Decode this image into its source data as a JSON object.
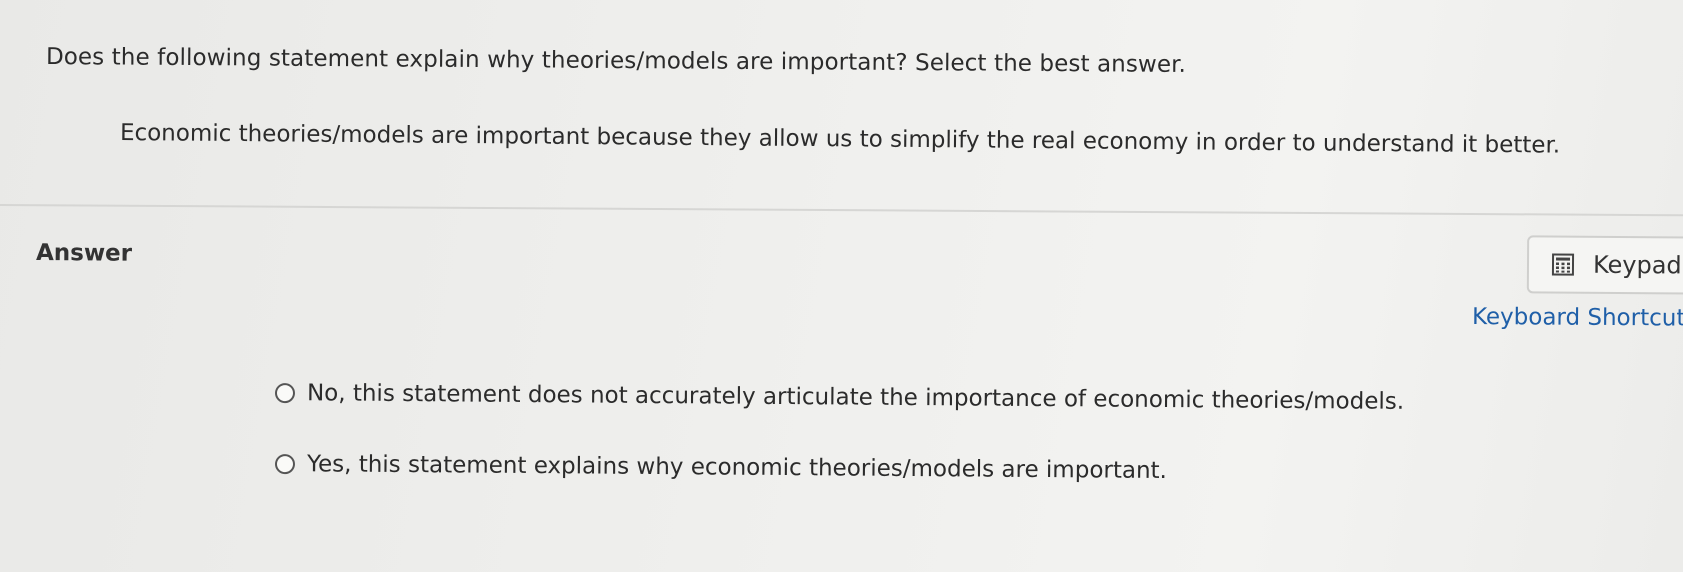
{
  "question": {
    "prompt": "Does the following statement explain why theories/models are important? Select the best answer.",
    "statement": "Economic theories/models are important because they allow us to simplify the real economy in order to understand it better."
  },
  "answer": {
    "heading": "Answer",
    "options": [
      {
        "label": "No, this statement does not accurately articulate the importance of economic theories/models.",
        "selected": false
      },
      {
        "label": "Yes, this statement explains why economic theories/models are important.",
        "selected": false
      }
    ]
  },
  "tools": {
    "keypad_label": "Keypad",
    "keypad_icon": "calculator-icon",
    "shortcuts_label": "Keyboard Shortcuts"
  },
  "colors": {
    "link": "#1f5fa8",
    "text": "#2b2b2b"
  }
}
